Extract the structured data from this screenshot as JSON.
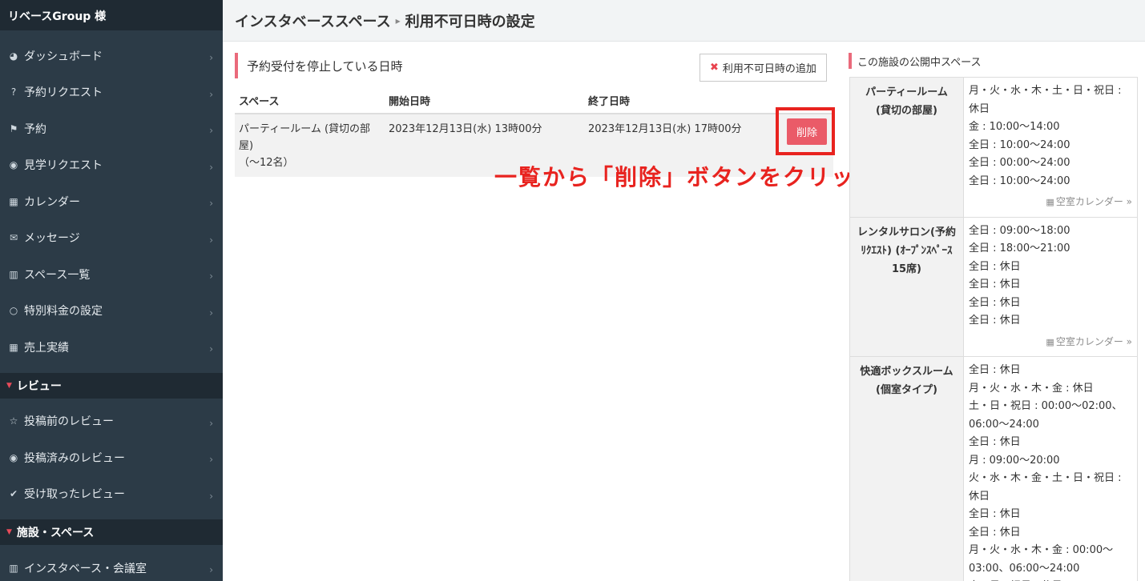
{
  "sidebar": {
    "account": "リベースGroup 様",
    "items": [
      {
        "label": "ダッシュボード",
        "icon": "dashboard-icon",
        "glyph": "◕"
      },
      {
        "label": "予約リクエスト",
        "icon": "question-icon",
        "glyph": "?"
      },
      {
        "label": "予約",
        "icon": "flag-icon",
        "glyph": "⚑"
      },
      {
        "label": "見学リクエスト",
        "icon": "eye-icon",
        "glyph": "◉"
      },
      {
        "label": "カレンダー",
        "icon": "calendar-icon",
        "glyph": "▦"
      },
      {
        "label": "メッセージ",
        "icon": "envelope-icon",
        "glyph": "✉"
      },
      {
        "label": "スペース一覧",
        "icon": "building-icon",
        "glyph": "▥"
      },
      {
        "label": "特別料金の設定",
        "icon": "circle-icon",
        "glyph": "○"
      },
      {
        "label": "売上実績",
        "icon": "calculator-icon",
        "glyph": "▦"
      }
    ],
    "review_section": "レビュー",
    "review_items": [
      {
        "label": "投稿前のレビュー",
        "icon": "star-icon",
        "glyph": "☆"
      },
      {
        "label": "投稿済みのレビュー",
        "icon": "eye-icon",
        "glyph": "◉"
      },
      {
        "label": "受け取ったレビュー",
        "icon": "check-icon",
        "glyph": "✔"
      }
    ],
    "facility_section": "施設・スペース",
    "facility_items": [
      {
        "label": "インスタベース・会議室",
        "icon": "building-icon",
        "glyph": "▥"
      }
    ]
  },
  "header": {
    "parent": "インスタベーススペース",
    "separator": "▸",
    "title": "利用不可日時の設定"
  },
  "main": {
    "section_title": "予約受付を停止している日時",
    "add_button": "利用不可日時の追加",
    "columns": [
      "スペース",
      "開始日時",
      "終了日時"
    ],
    "rows": [
      {
        "space_line1": "パーティールーム (貸切の部",
        "space_line2": "屋)",
        "space_line3": "（〜12名）",
        "start": "2023年12月13日(水) 13時00分",
        "end": "2023年12月13日(水) 17時00分",
        "delete": "削除"
      }
    ],
    "annotation": "一覧から「削除」ボタンをクリック"
  },
  "right_panel": {
    "title": "この施設の公開中スペース",
    "calendar_link": "空室カレンダー »",
    "spaces": [
      {
        "name_lines": [
          "パーティールーム",
          "(貸切の部屋)"
        ],
        "hours": [
          "月・火・水・木・土・日・祝日 :",
          "休日",
          "金 : 10:00〜14:00",
          "全日 : 10:00〜24:00",
          "全日 : 00:00〜24:00",
          "全日 : 10:00〜24:00"
        ],
        "show_calendar": true
      },
      {
        "name_lines": [
          "レンタルサロン(予約",
          "ﾘｸｴｽﾄ) (ｵｰﾌﾟﾝｽﾍﾟｰｽ",
          "15席)"
        ],
        "hours": [
          "全日 : 09:00〜18:00",
          "全日 : 18:00〜21:00",
          "全日 : 休日",
          "全日 : 休日",
          "全日 : 休日",
          "全日 : 休日"
        ],
        "show_calendar": true
      },
      {
        "name_lines": [
          "快適ボックスルーム",
          "(個室タイプ)"
        ],
        "hours": [
          "全日 : 休日",
          "月・火・水・木・金 : 休日",
          "土・日・祝日 : 00:00〜02:00、",
          "06:00〜24:00",
          "全日 : 休日",
          "月 : 09:00〜20:00",
          "火・水・木・金・土・日・祝日 :",
          "休日",
          "全日 : 休日",
          "全日 : 休日",
          "月・火・水・木・金 : 00:00〜",
          "03:00、06:00〜24:00",
          "土・日・祝日 : 休日"
        ],
        "show_calendar": false
      }
    ]
  },
  "colors": {
    "sidebar_bg": "#2c3b47",
    "accent": "#ea6a7b",
    "delete_button": "#ea5b68",
    "annotation": "#e8231f"
  }
}
